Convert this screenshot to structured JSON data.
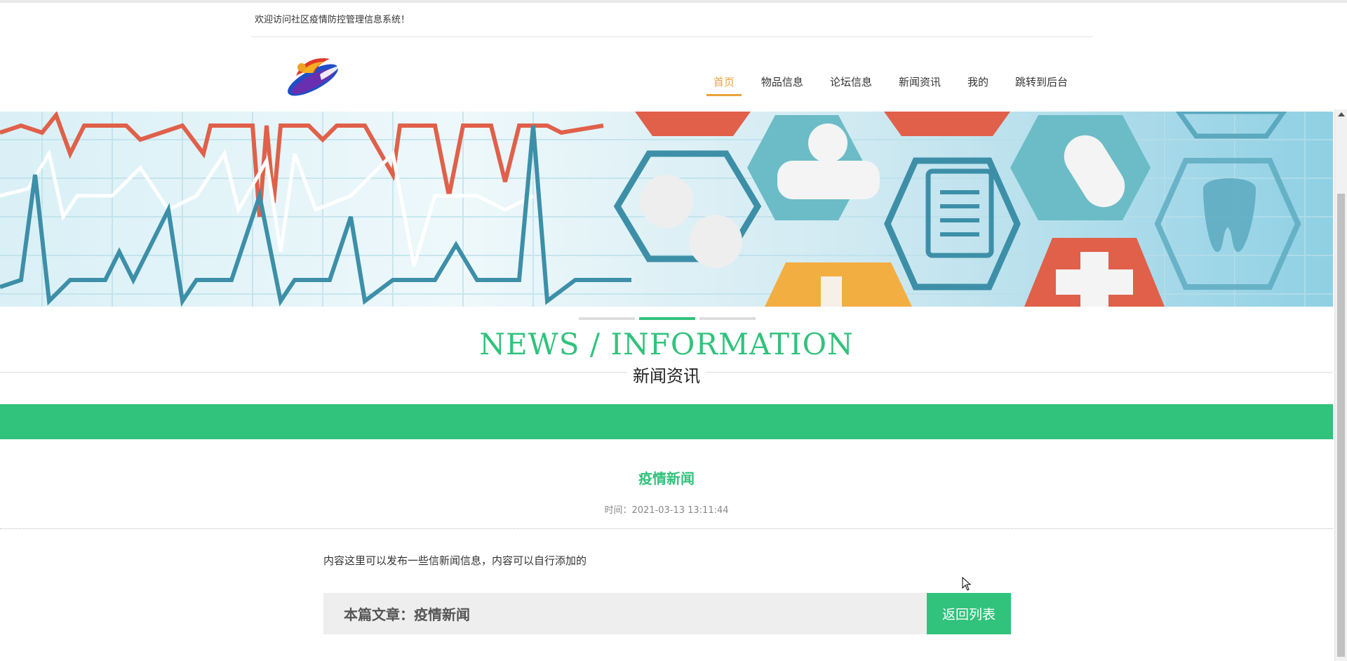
{
  "topbar": {
    "welcome": "欢迎访问社区疫情防控管理信息系统！"
  },
  "nav": {
    "items": [
      {
        "label": "首页",
        "active": true
      },
      {
        "label": "物品信息",
        "active": false
      },
      {
        "label": "论坛信息",
        "active": false
      },
      {
        "label": "新闻资讯",
        "active": false
      },
      {
        "label": "我的",
        "active": false
      },
      {
        "label": "跳转到后台",
        "active": false
      }
    ]
  },
  "banner": {
    "slides": 3,
    "active_slide": 2
  },
  "section": {
    "title": "NEWS / INFORMATION",
    "subtitle": "新闻资讯"
  },
  "article": {
    "title": "疫情新闻",
    "time": "时间：2021-03-13 13:11:44",
    "content": "内容这里可以发布一些信新闻信息，内容可以自行添加的",
    "footer_label": "本篇文章：疫情新闻",
    "back_label": "返回列表"
  },
  "colors": {
    "accent_green": "#31c27c",
    "nav_active": "#e8a33a"
  }
}
